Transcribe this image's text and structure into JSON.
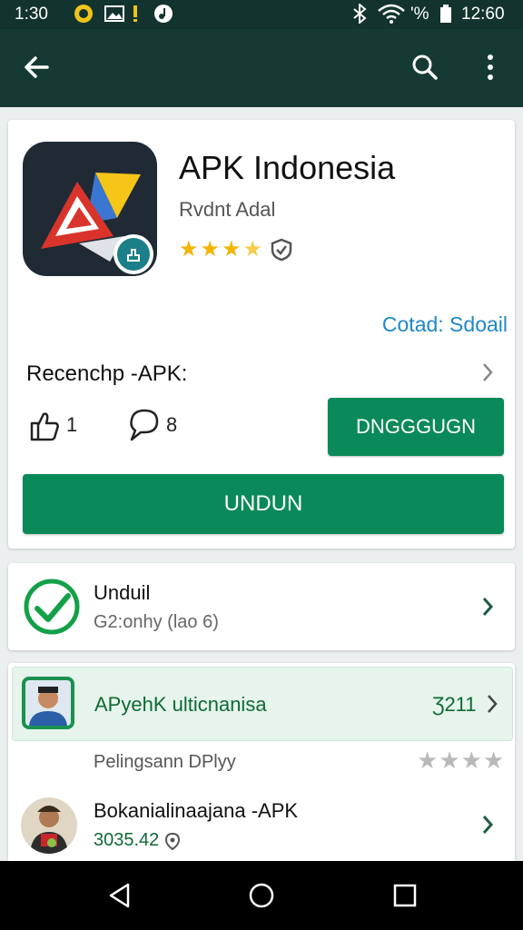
{
  "status_bar": {
    "time_left": "1:30",
    "battery": "'%",
    "time_right": "12:60"
  },
  "app_bar": {
    "back_icon": "arrow-left-icon",
    "search_icon": "search-icon",
    "menu_icon": "more-vert-icon"
  },
  "app": {
    "title": "APK Indonesia",
    "developer": "Rvdnt Adal",
    "rating_stars": 3.5,
    "contact_label": "Cotad: Sdoail",
    "section_label": "Recenchp -APK:",
    "like_count": "1",
    "comment_count": "8",
    "secondary_button": "DNGGGUGN",
    "primary_button": "UNDUN"
  },
  "download_row": {
    "title": "Unduil",
    "subtitle": "G2:onhy (lao  6)"
  },
  "highlight_row": {
    "title": "APyehK ulticnanisa",
    "value": "Ʒ211"
  },
  "review_header": {
    "label": "Pelingsann  DPlyy",
    "rating_stars": 4
  },
  "review_row": {
    "title": "Bokanialinaajana -APK",
    "value": "3035.42"
  },
  "colors": {
    "appbar": "#153a33",
    "status_bar": "#13342e",
    "primary_green": "#0a8a58",
    "link_blue": "#1e88c8",
    "star": "#f4b400"
  }
}
